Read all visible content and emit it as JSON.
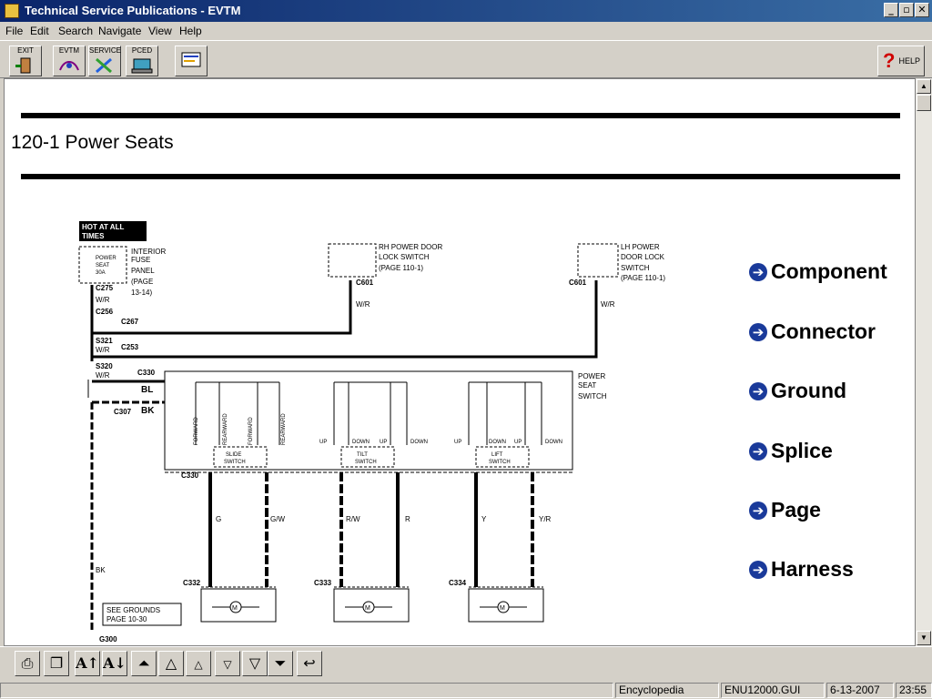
{
  "window": {
    "title": "Technical Service Publications - EVTM"
  },
  "menu": [
    "File",
    "Edit",
    "Search",
    "Navigate",
    "View",
    "Help"
  ],
  "toolbar": {
    "exit": "EXIT",
    "evtm": "EVTM",
    "service": "SERVICE",
    "pced": "PCED",
    "help": "HELP"
  },
  "page": {
    "title": "120-1 Power Seats"
  },
  "nav_links": [
    "Component",
    "Connector",
    "Ground",
    "Splice",
    "Page",
    "Harness"
  ],
  "diagram": {
    "hot": "HOT AT ALL",
    "times": "TIMES",
    "fuse_panel": [
      "INTERIOR",
      "FUSE",
      "PANEL",
      "(PAGE",
      "13-14)"
    ],
    "fuse": [
      "POWER",
      "SEAT",
      "30A"
    ],
    "rh_lock": [
      "RH POWER DOOR",
      "LOCK SWITCH",
      "(PAGE 110-1)"
    ],
    "lh_lock": [
      "LH POWER",
      "DOOR LOCK",
      "SWITCH",
      "(PAGE 110-1)"
    ],
    "power_seat_switch": [
      "POWER",
      "SEAT",
      "SWITCH"
    ],
    "connectors": {
      "c275": "C275",
      "c256": "C256",
      "c267": "C267",
      "s321": "S321",
      "c253": "C253",
      "s320": "S320",
      "c330": "C330",
      "c307": "C307",
      "c601a": "C601",
      "c601b": "C601",
      "c330b": "C330",
      "c332": "C332",
      "c333": "C333",
      "c334": "C334",
      "g300": "G300"
    },
    "wires": {
      "wr1": "W/R",
      "wr2": "W/R",
      "wr3": "W/R",
      "wr4": "W/R",
      "wr5": "W/R",
      "bl": "BL",
      "bk1": "BK",
      "bk2": "BK",
      "g": "G",
      "gw": "G/W",
      "rw": "R/W",
      "r": "R",
      "y": "Y",
      "yr": "Y/R"
    },
    "switch_labels": {
      "forward1": "FORWARD",
      "rearward1": "REARWARD",
      "forward2": "FORWARD",
      "rearward2": "REARWARD",
      "up": "UP",
      "down": "DOWN"
    },
    "sub_switches": [
      "SLIDE",
      "SWITCH",
      "TILT",
      "SWITCH",
      "LIFT",
      "SWITCH"
    ],
    "grounds_note": [
      "SEE GROUNDS",
      "PAGE 10-30"
    ],
    "motor": "M"
  },
  "status": {
    "mode": "Encyclopedia",
    "file": "ENU12000.GUI",
    "date": "6-13-2007",
    "time": "23:55"
  }
}
